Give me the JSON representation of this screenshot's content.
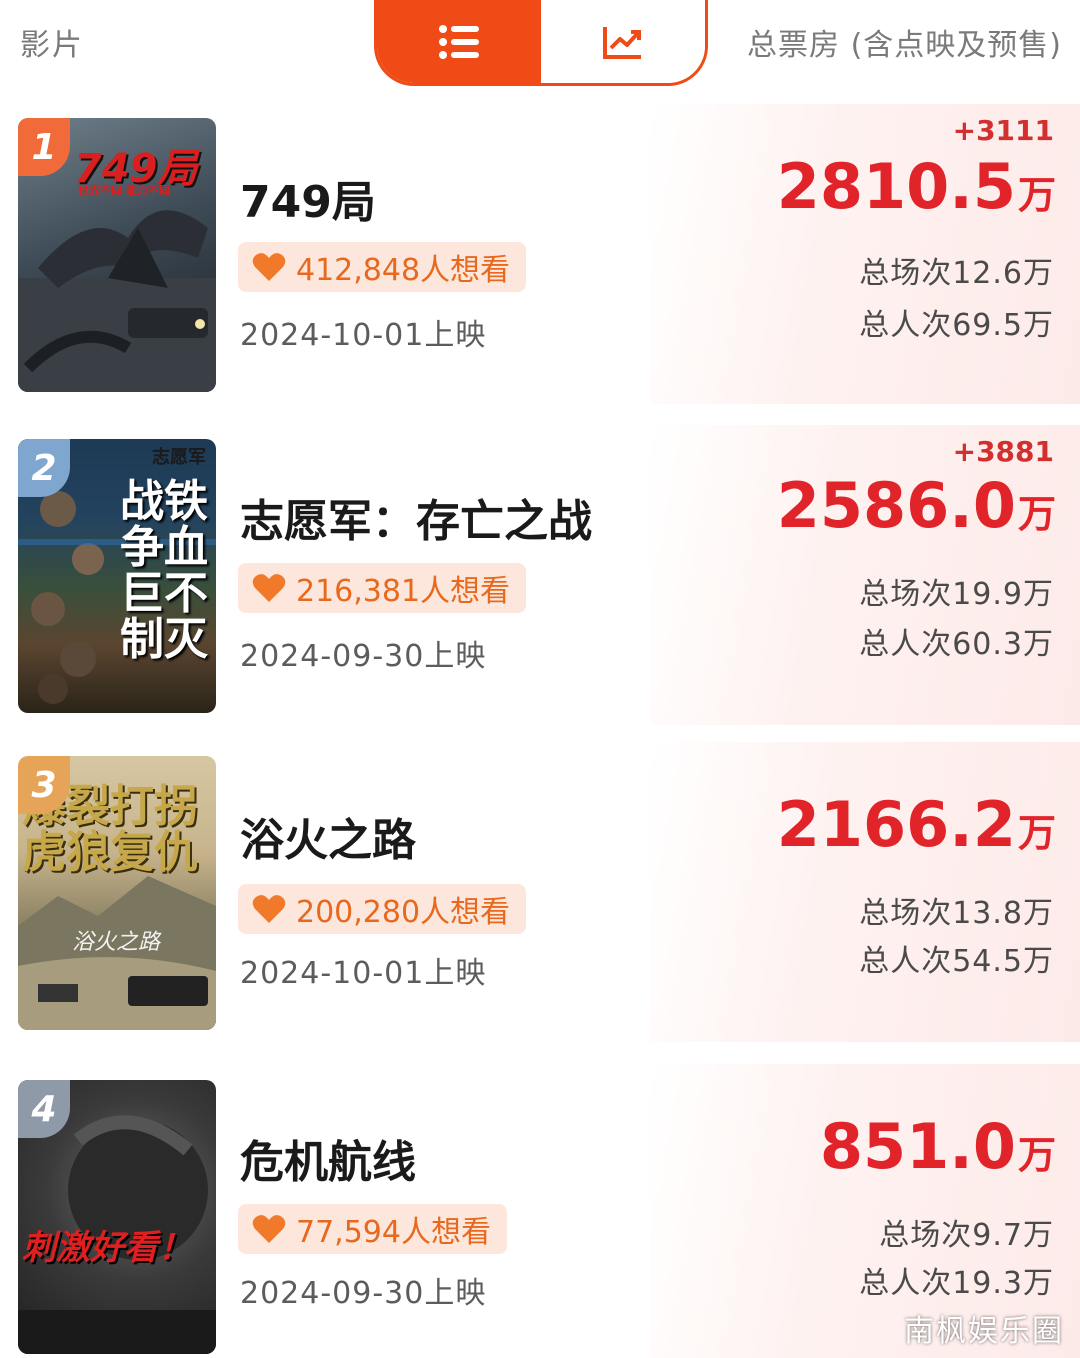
{
  "header": {
    "left_label": "影片",
    "right_label": "总票房 (含点映及预售)",
    "view_toggle": {
      "active": "list-icon",
      "inactive": "trend-chart-icon"
    }
  },
  "colors": {
    "accent": "#f04b16",
    "box_office": "#e0242a",
    "want_bg": "#fde7dc",
    "want_text": "#e8691e"
  },
  "movies": [
    {
      "rank": "1",
      "title": "749局",
      "want_count": "412,848人想看",
      "release": "2024-10-01上映",
      "delta": "+3111",
      "box_value": "2810.5",
      "box_unit": "万",
      "screenings": "总场次12.6万",
      "attendance": "总人次69.5万",
      "poster_text": "749局",
      "poster_sub": "世界不同 能力不同"
    },
    {
      "rank": "2",
      "title": "志愿军：存亡之战",
      "want_count": "216,381人想看",
      "release": "2024-09-30上映",
      "delta": "+3881",
      "box_value": "2586.0",
      "box_unit": "万",
      "screenings": "总场次19.9万",
      "attendance": "总人次60.3万",
      "poster_text": "志愿军",
      "poster_lines": [
        "战铁",
        "争血",
        "巨不",
        "制灭"
      ]
    },
    {
      "rank": "3",
      "title": "浴火之路",
      "want_count": "200,280人想看",
      "release": "2024-10-01上映",
      "delta": "",
      "box_value": "2166.2",
      "box_unit": "万",
      "screenings": "总场次13.8万",
      "attendance": "总人次54.5万",
      "poster_lines": [
        "爆裂打拐",
        "虎狼复仇"
      ],
      "poster_sub": "浴火之路"
    },
    {
      "rank": "4",
      "title": "危机航线",
      "want_count": "77,594人想看",
      "release": "2024-09-30上映",
      "delta": "",
      "box_value": "851.0",
      "box_unit": "万",
      "screenings": "总场次9.7万",
      "attendance": "总人次19.3万",
      "poster_text": "刺激好看！"
    }
  ],
  "watermark": "南枫娱乐圈"
}
